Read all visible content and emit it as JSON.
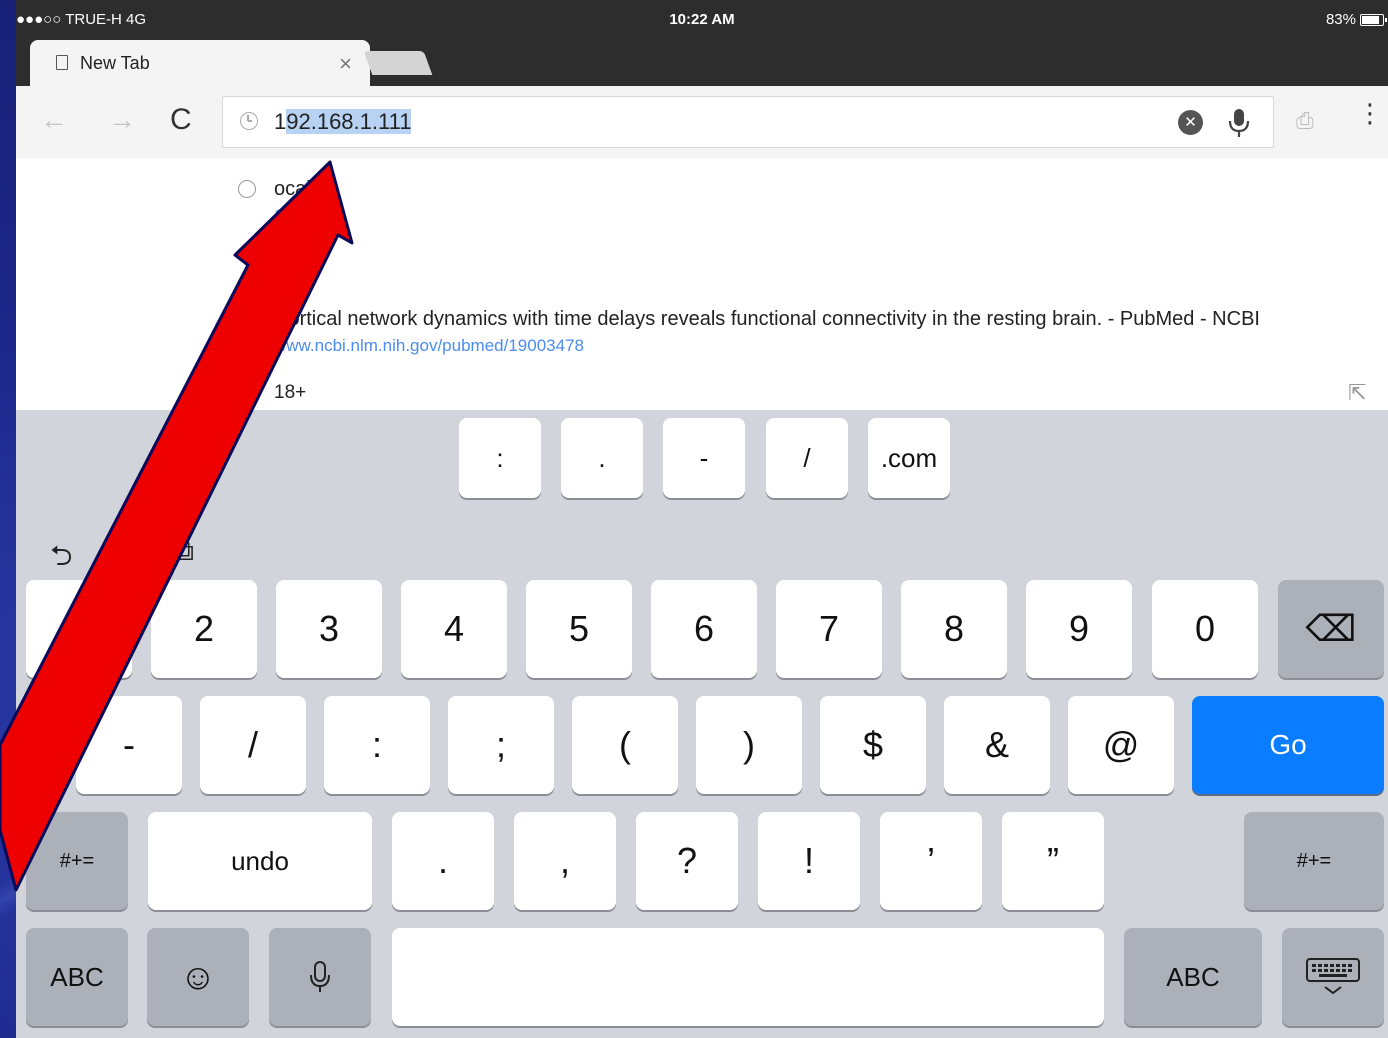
{
  "status_bar": {
    "carrier": "●●●○○ TRUE-H  4G",
    "time": "10:22 AM",
    "battery": "83%",
    "battery_level": 0.83
  },
  "tab": {
    "title": "New Tab",
    "close_glyph": "×"
  },
  "toolbar": {
    "back_glyph": "←",
    "forward_glyph": "→",
    "reload_glyph": "C",
    "url_prefix": "1",
    "url_selected": "92.168.1.111",
    "clear_glyph": "✕",
    "share_glyph": "⎙",
    "menu_glyph": "⋮"
  },
  "suggestions": [
    {
      "title": "ocal",
      "subtitle": "1.111"
    },
    {
      "title": "Cortical network dynamics with time delays reveals functional connectivity in the resting brain. - PubMed - NCBI",
      "subtitle": "www.ncbi.nlm.nih.gov/pubmed/19003478"
    },
    {
      "title": "18+",
      "search_glyph": "⚲",
      "arrow_glyph": "⇱"
    }
  ],
  "keyboard": {
    "shortcut_row": [
      ":",
      ".",
      "-",
      "/",
      ".com"
    ],
    "row1": [
      "",
      "2",
      "3",
      "4",
      "5",
      "6",
      "7",
      "8",
      "9",
      "0"
    ],
    "backspace_glyph": "⌫",
    "row2": [
      "-",
      "/",
      ":",
      ";",
      "(",
      ")",
      "$",
      "&",
      "@"
    ],
    "go_label": "Go",
    "row3_left": "#+=",
    "undo_label": "undo",
    "row3": [
      ".",
      ",",
      "?",
      "!",
      "’",
      "”"
    ],
    "row3_right": "#+=",
    "abc_left": "ABC",
    "emoji_glyph": "☺",
    "abc_right": "ABC",
    "undo_glyph": "⮌",
    "paste_glyph": "⧉"
  },
  "colors": {
    "annotation_arrow": "#ee0000",
    "go_key": "#0a7cff",
    "link": "#4a8cf0"
  }
}
